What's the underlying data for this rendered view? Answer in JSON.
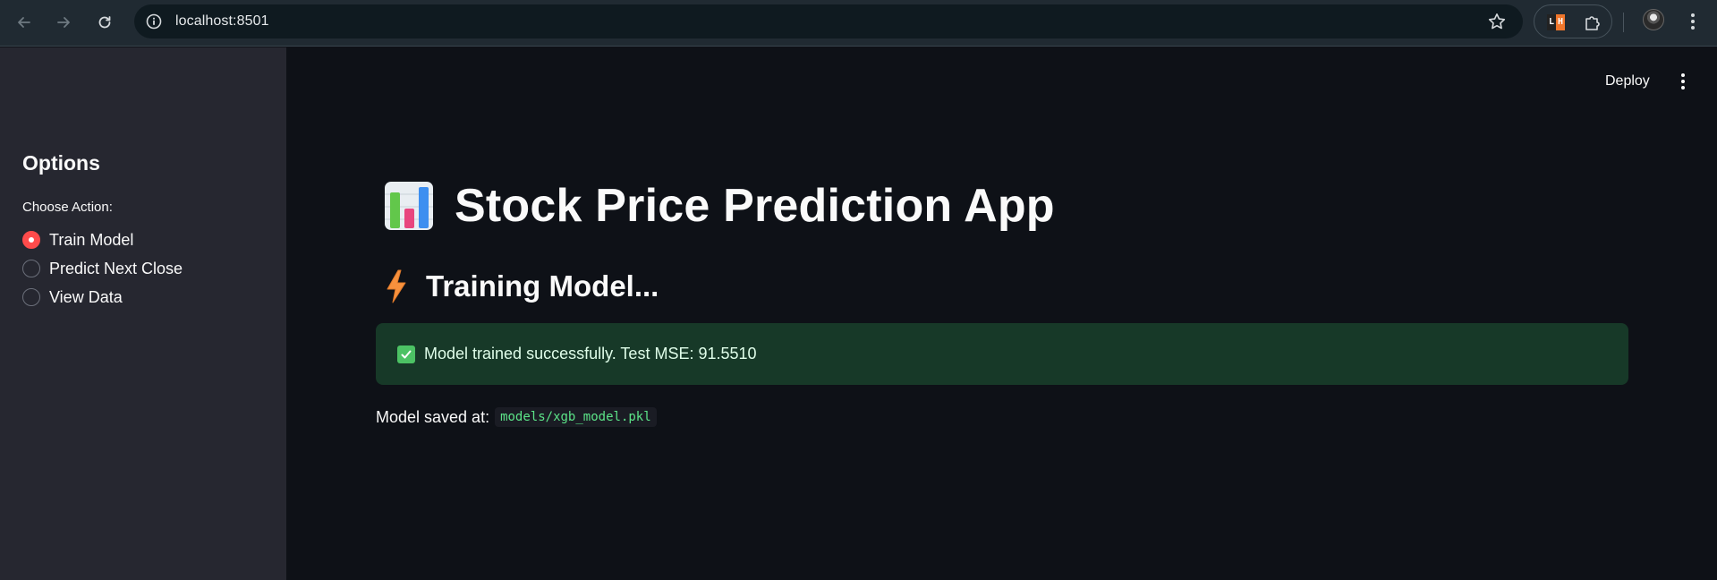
{
  "browser": {
    "url": "localhost:8501",
    "back_icon": "back-arrow-icon",
    "forward_icon": "forward-arrow-icon",
    "reload_icon": "reload-icon",
    "site_info_icon": "site-info-icon",
    "bookmark_icon": "star-icon",
    "extensions": [
      {
        "name": "lighthouse-icon",
        "glyphs": [
          "L",
          "H"
        ]
      },
      {
        "name": "puzzle-icon"
      }
    ],
    "avatar_icon": "profile-avatar-icon",
    "menu_icon": "kebab-menu-icon"
  },
  "header": {
    "deploy_label": "Deploy",
    "menu_icon": "kebab-menu-icon"
  },
  "sidebar": {
    "title": "Options",
    "radio_label": "Choose Action:",
    "options": [
      {
        "label": "Train Model",
        "checked": true
      },
      {
        "label": "Predict Next Close",
        "checked": false
      },
      {
        "label": "View Data",
        "checked": false
      }
    ]
  },
  "main": {
    "title_icon": "bar-chart-icon",
    "title": "Stock Price Prediction App",
    "subheader_icon": "lightning-icon",
    "subheader": "Training Model...",
    "success_icon": "check-mark-icon",
    "success_message": "Model trained successfully. Test MSE: 91.5510",
    "saved_label": "Model saved at:",
    "saved_path": "models/xgb_model.pkl"
  },
  "colors": {
    "app_background": "#0e1117",
    "sidebar_background": "#262730",
    "accent": "#ff4b4b",
    "success_background": "#173928",
    "success_text": "#dffde9",
    "code_text": "#5ce488"
  }
}
